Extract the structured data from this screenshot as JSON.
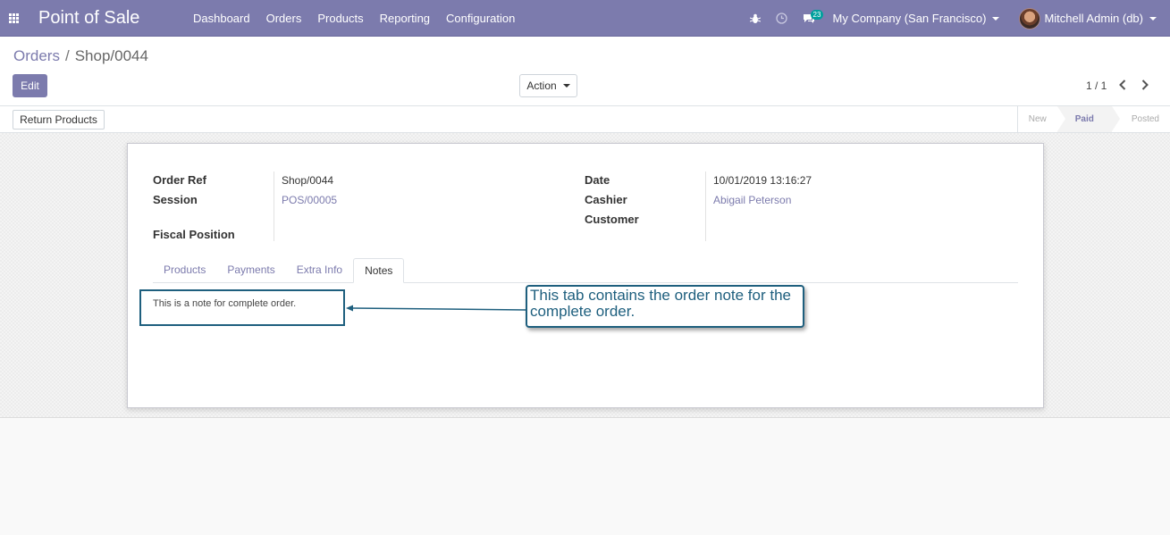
{
  "navbar": {
    "app_title": "Point of Sale",
    "menu": [
      "Dashboard",
      "Orders",
      "Products",
      "Reporting",
      "Configuration"
    ],
    "messages_count": "23",
    "company": "My Company (San Francisco)",
    "user": "Mitchell Admin (db)",
    "bg_color": "#7c7bad"
  },
  "breadcrumb": {
    "parent": "Orders",
    "separator": "/",
    "current": "Shop/0044"
  },
  "control": {
    "edit_label": "Edit",
    "action_label": "Action",
    "pager": "1 / 1"
  },
  "statusbar": {
    "return_label": "Return Products",
    "stages": [
      "New",
      "Paid",
      "Posted"
    ],
    "active_stage": "Paid"
  },
  "form": {
    "order_ref_label": "Order Ref",
    "order_ref_value": "Shop/0044",
    "session_label": "Session",
    "session_value": "POS/00005",
    "fiscal_label": "Fiscal Position",
    "date_label": "Date",
    "date_value": "10/01/2019 13:16:27",
    "cashier_label": "Cashier",
    "cashier_value": "Abigail Peterson",
    "customer_label": "Customer"
  },
  "tabs": [
    "Products",
    "Payments",
    "Extra Info",
    "Notes"
  ],
  "active_tab": "Notes",
  "note": "This is a note for complete order.",
  "callout": "This tab contains the order note for the complete order.",
  "colors": {
    "accent": "#7c7bad",
    "callout": "#1e5f7e"
  }
}
